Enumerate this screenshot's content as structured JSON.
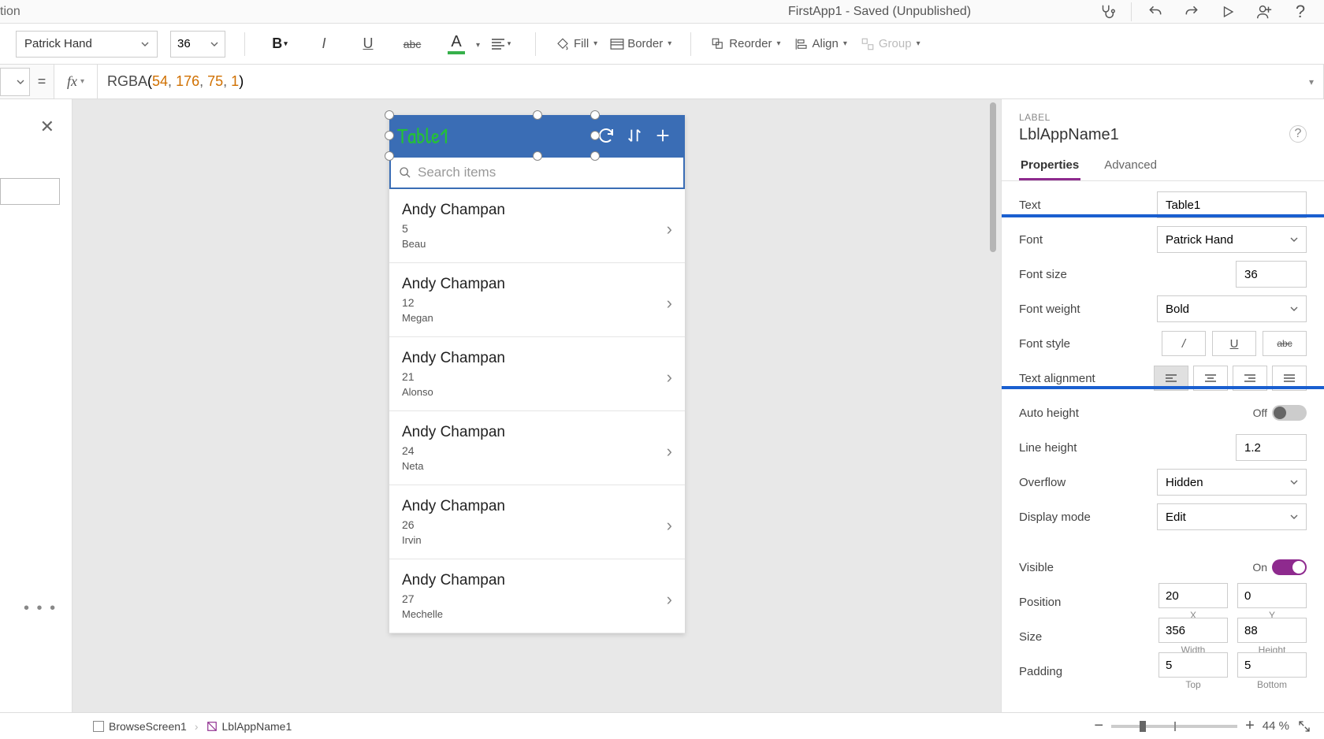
{
  "title_bar": {
    "partial_text": "tion",
    "app_title": "FirstApp1 - Saved (Unpublished)"
  },
  "ribbon": {
    "font": "Patrick Hand",
    "font_size": "36",
    "fill_label": "Fill",
    "border_label": "Border",
    "reorder_label": "Reorder",
    "align_label": "Align",
    "group_label": "Group"
  },
  "formula": {
    "expr_func": "RGBA",
    "n1": "54",
    "n2": "176",
    "n3": "75",
    "n4": "1"
  },
  "phone": {
    "header_title": "Table1",
    "search_placeholder": "Search items",
    "items": [
      {
        "name": "Andy Champan",
        "id": "5",
        "sub": "Beau"
      },
      {
        "name": "Andy Champan",
        "id": "12",
        "sub": "Megan"
      },
      {
        "name": "Andy Champan",
        "id": "21",
        "sub": "Alonso"
      },
      {
        "name": "Andy Champan",
        "id": "24",
        "sub": "Neta"
      },
      {
        "name": "Andy Champan",
        "id": "26",
        "sub": "Irvin"
      },
      {
        "name": "Andy Champan",
        "id": "27",
        "sub": "Mechelle"
      }
    ]
  },
  "right_panel": {
    "type_label": "LABEL",
    "control_name": "LblAppName1",
    "tabs": {
      "properties": "Properties",
      "advanced": "Advanced"
    },
    "text": {
      "label": "Text",
      "value": "Table1"
    },
    "font": {
      "label": "Font",
      "value": "Patrick Hand"
    },
    "font_size": {
      "label": "Font size",
      "value": "36"
    },
    "font_weight": {
      "label": "Font weight",
      "value": "Bold"
    },
    "font_style": {
      "label": "Font style"
    },
    "text_align": {
      "label": "Text alignment"
    },
    "auto_height": {
      "label": "Auto height",
      "state": "Off"
    },
    "line_height": {
      "label": "Line height",
      "value": "1.2"
    },
    "overflow": {
      "label": "Overflow",
      "value": "Hidden"
    },
    "display_mode": {
      "label": "Display mode",
      "value": "Edit"
    },
    "visible": {
      "label": "Visible",
      "state": "On"
    },
    "position": {
      "label": "Position",
      "x": "20",
      "y": "0",
      "xl": "X",
      "yl": "Y"
    },
    "size": {
      "label": "Size",
      "w": "356",
      "h": "88",
      "wl": "Width",
      "hl": "Height"
    },
    "padding": {
      "label": "Padding",
      "t": "5",
      "b": "5",
      "tl": "Top",
      "bl": "Bottom"
    }
  },
  "bottom_bar": {
    "bc1": "BrowseScreen1",
    "bc2": "LblAppName1",
    "zoom_pct": "44",
    "zoom_suffix": "%"
  }
}
